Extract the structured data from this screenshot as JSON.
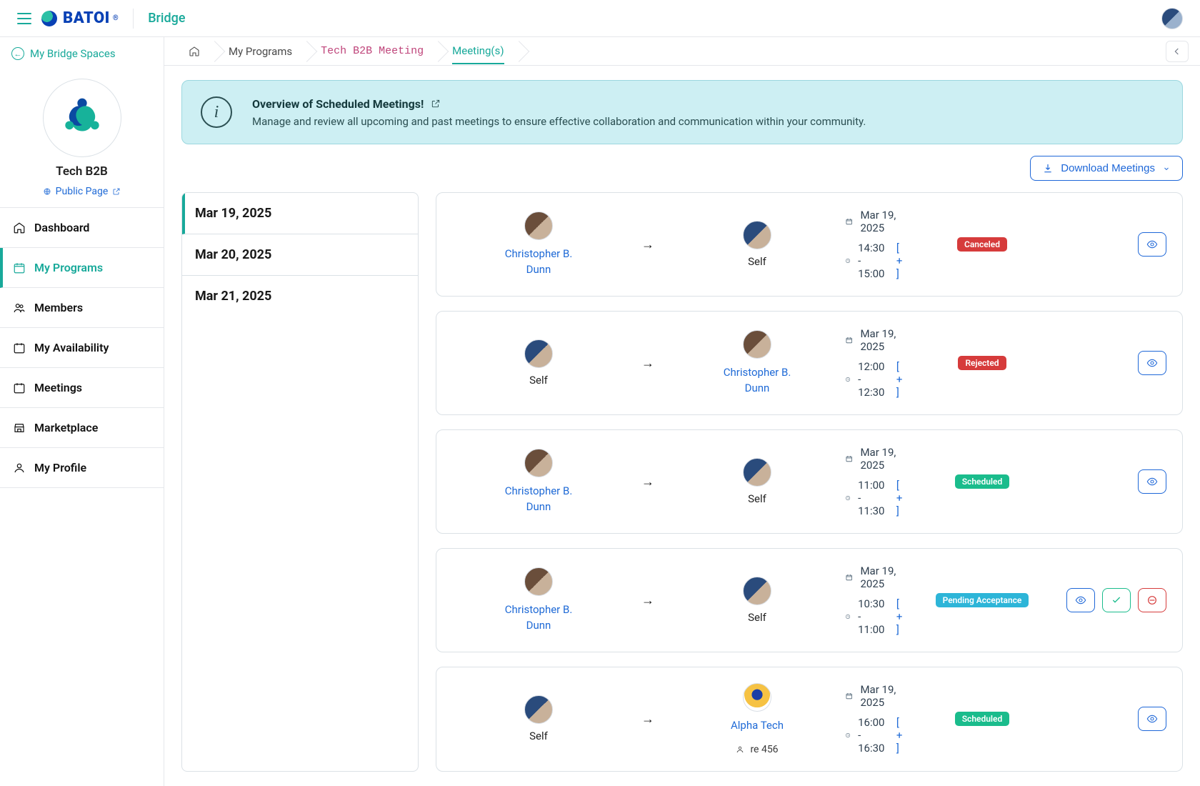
{
  "header": {
    "brand_text": "BATOI",
    "app_name": "Bridge"
  },
  "sidebar": {
    "back_label": "My Bridge Spaces",
    "org_name": "Tech B2B",
    "public_page_label": "Public Page",
    "items": [
      {
        "label": "Dashboard",
        "icon": "home"
      },
      {
        "label": "My Programs",
        "icon": "calendar",
        "active": true
      },
      {
        "label": "Members",
        "icon": "users"
      },
      {
        "label": "My Availability",
        "icon": "calendar-box"
      },
      {
        "label": "Meetings",
        "icon": "calendar-box"
      },
      {
        "label": "Marketplace",
        "icon": "store"
      },
      {
        "label": "My Profile",
        "icon": "user"
      }
    ]
  },
  "breadcrumbs": {
    "items": [
      {
        "label": "",
        "home": true
      },
      {
        "label": "My Programs"
      },
      {
        "label": "Tech B2B Meeting",
        "pink": true
      },
      {
        "label": "Meeting(s)",
        "current": true
      }
    ]
  },
  "banner": {
    "title": "Overview of Scheduled Meetings!",
    "description": "Manage and review all upcoming and past meetings to ensure effective collaboration and communication within your community."
  },
  "toolbar": {
    "download_label": "Download Meetings"
  },
  "date_tabs": [
    {
      "label": "Mar 19, 2025",
      "active": true
    },
    {
      "label": "Mar 20, 2025"
    },
    {
      "label": "Mar 21, 2025"
    }
  ],
  "plus_label": "[ + ]",
  "meetings": [
    {
      "from": {
        "name": "Christopher B. Dunn",
        "link": true,
        "avatar": "alt"
      },
      "to": {
        "name": "Self",
        "link": false,
        "avatar": "std"
      },
      "date": "Mar 19, 2025",
      "time": "14:30 - 15:00",
      "status": {
        "label": "Canceled",
        "kind": "canceled"
      },
      "actions": [
        "view"
      ]
    },
    {
      "from": {
        "name": "Self",
        "link": false,
        "avatar": "std"
      },
      "to": {
        "name": "Christopher B. Dunn",
        "link": true,
        "avatar": "alt"
      },
      "date": "Mar 19, 2025",
      "time": "12:00 - 12:30",
      "status": {
        "label": "Rejected",
        "kind": "rejected"
      },
      "actions": [
        "view"
      ]
    },
    {
      "from": {
        "name": "Christopher B. Dunn",
        "link": true,
        "avatar": "alt"
      },
      "to": {
        "name": "Self",
        "link": false,
        "avatar": "std"
      },
      "date": "Mar 19, 2025",
      "time": "11:00 - 11:30",
      "status": {
        "label": "Scheduled",
        "kind": "scheduled"
      },
      "actions": [
        "view"
      ]
    },
    {
      "from": {
        "name": "Christopher B. Dunn",
        "link": true,
        "avatar": "alt"
      },
      "to": {
        "name": "Self",
        "link": false,
        "avatar": "std"
      },
      "date": "Mar 19, 2025",
      "time": "10:30 - 11:00",
      "status": {
        "label": "Pending Acceptance",
        "kind": "pending"
      },
      "actions": [
        "view",
        "accept",
        "decline"
      ]
    },
    {
      "from": {
        "name": "Self",
        "link": false,
        "avatar": "std"
      },
      "to": {
        "name": "Alpha Tech",
        "link": true,
        "avatar": "logo",
        "extra_prefix": "re 456"
      },
      "date": "Mar 19, 2025",
      "time": "16:00 - 16:30",
      "status": {
        "label": "Scheduled",
        "kind": "scheduled"
      },
      "actions": [
        "view"
      ]
    }
  ]
}
